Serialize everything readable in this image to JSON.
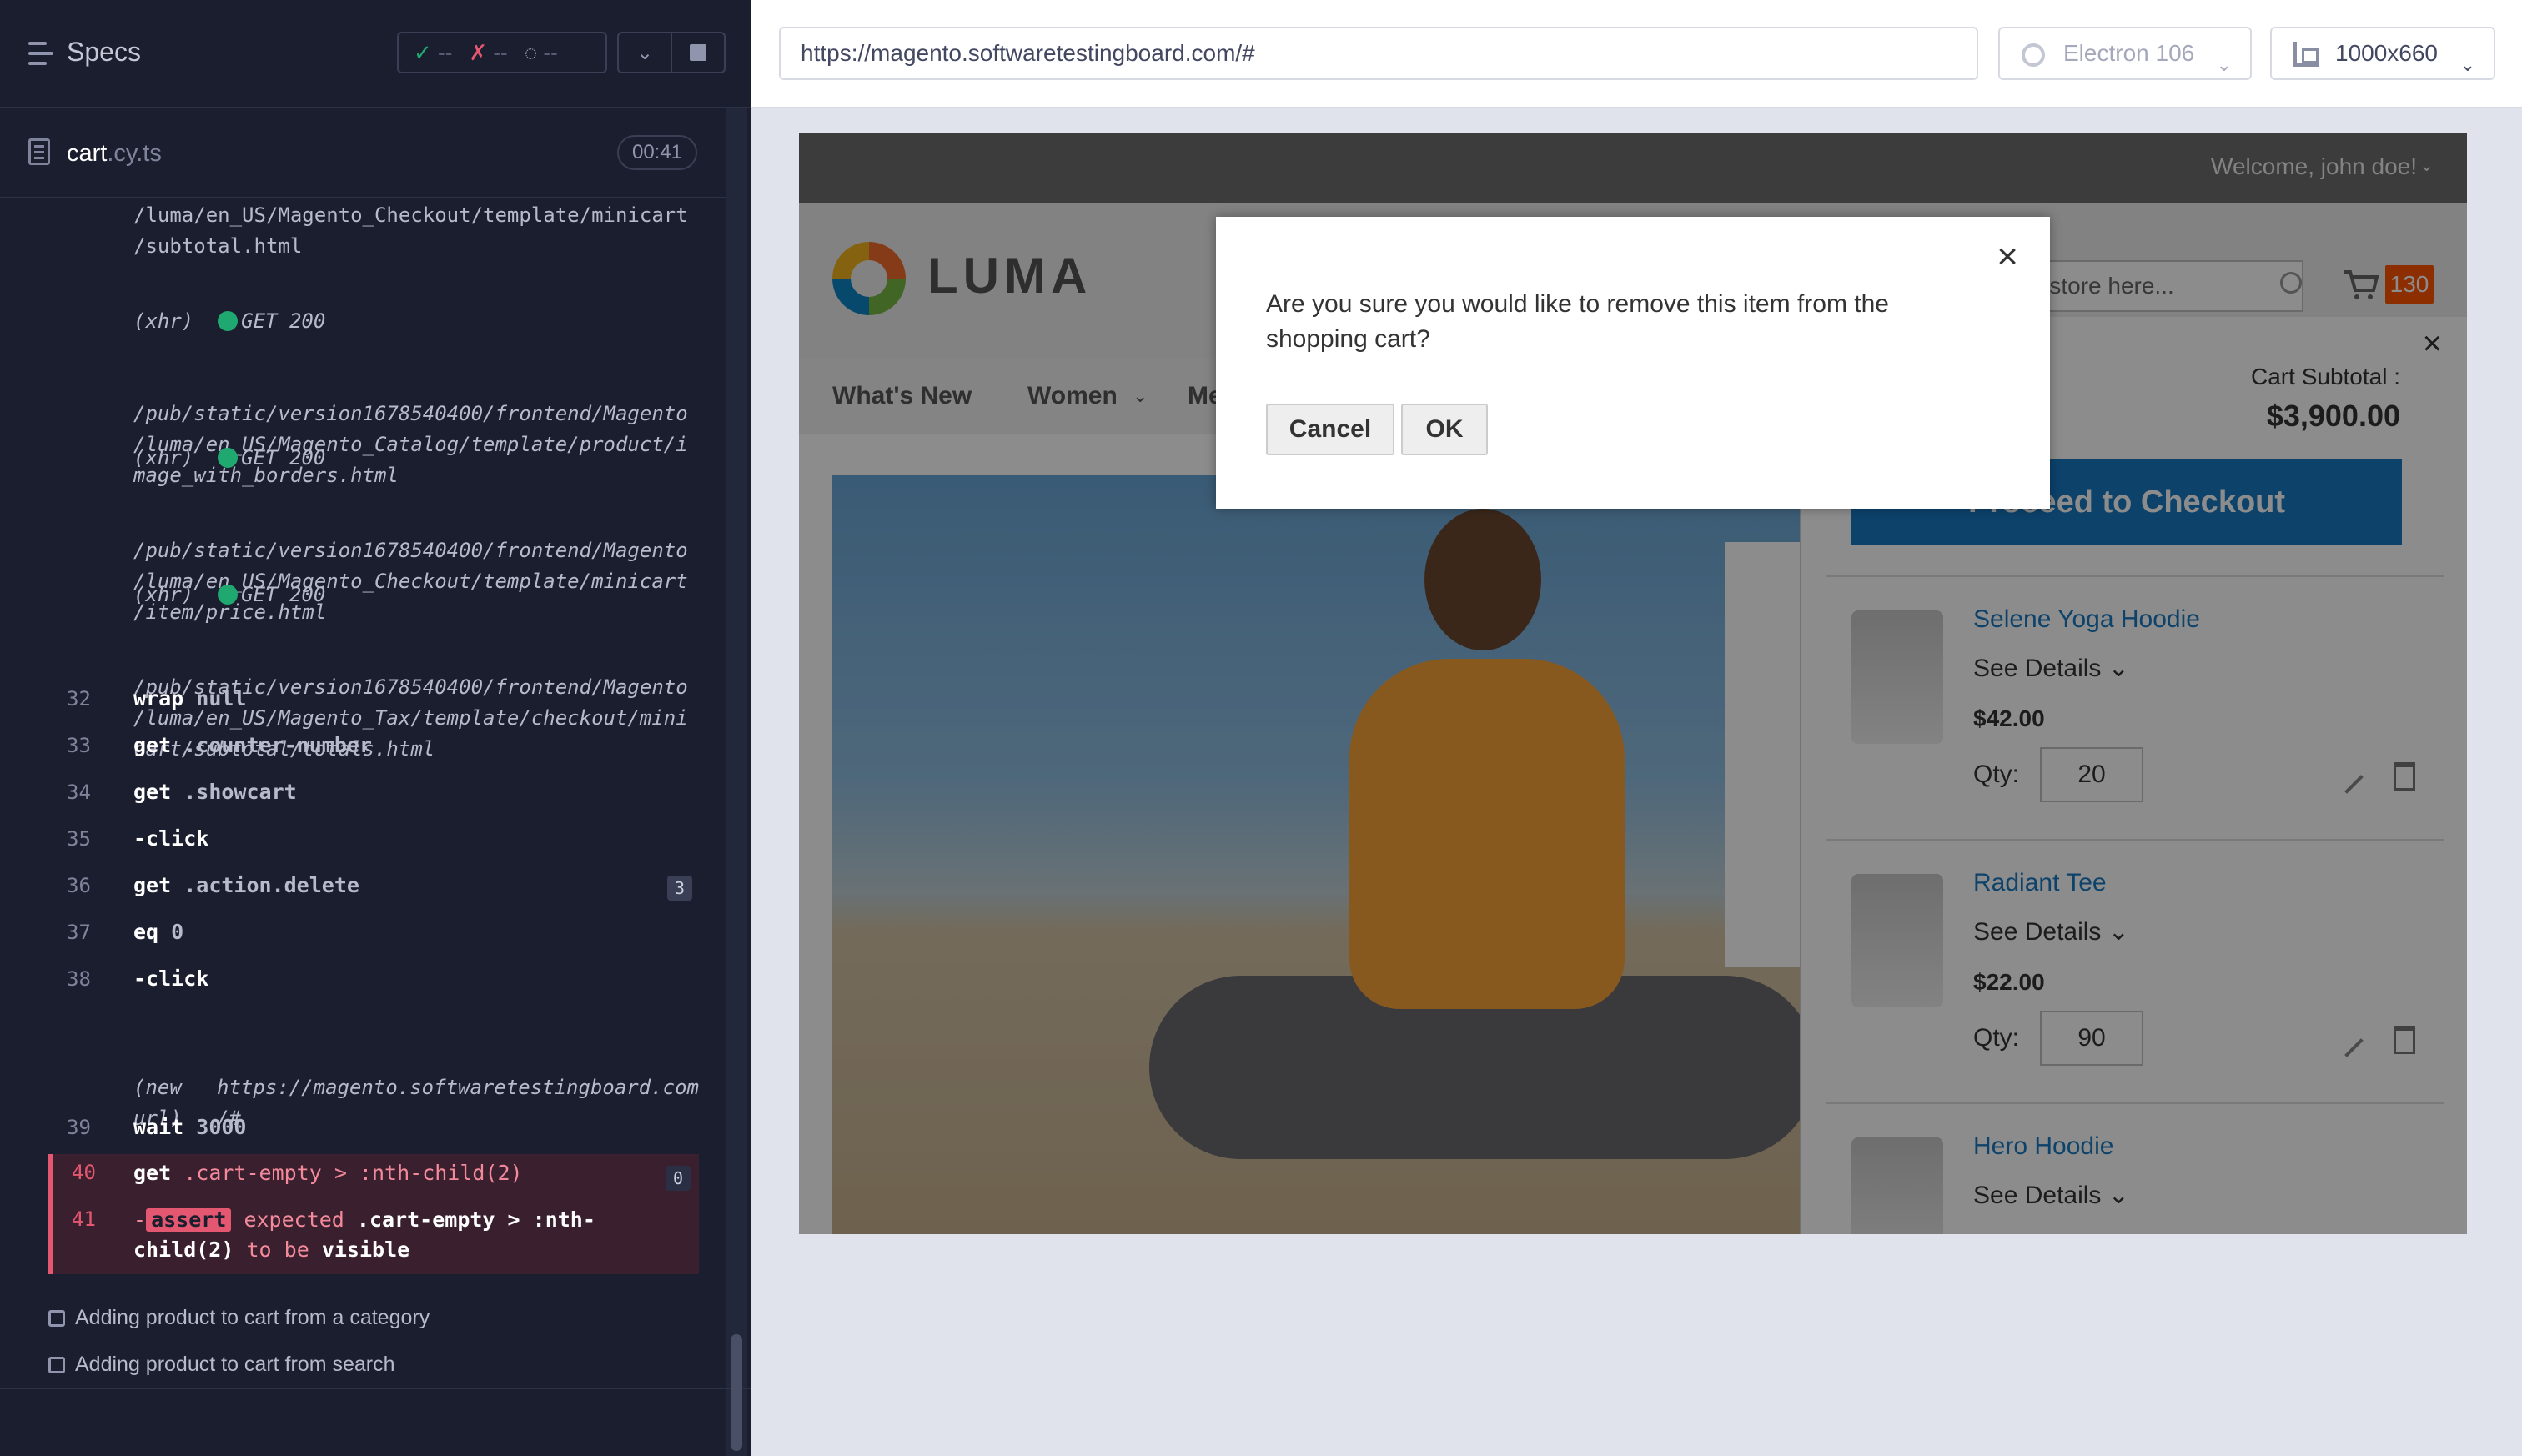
{
  "runner": {
    "title": "Specs",
    "stats": {
      "passed": "--",
      "failed": "--",
      "pending": "--"
    },
    "spec_file": {
      "name": "cart",
      "ext": ".cy.ts",
      "timer": "00:41"
    },
    "xhr_prefix_cont": "/luma/en_US/Magento_Checkout/template/minicart\n/subtotal.html",
    "xhr": [
      {
        "label": "(xhr)",
        "method": "GET 200",
        "url": "/pub/static/version1678540400/frontend/Magento\n/luma/en_US/Magento_Catalog/template/product/i\nmage_with_borders.html"
      },
      {
        "label": "(xhr)",
        "method": "GET 200",
        "url": "/pub/static/version1678540400/frontend/Magento\n/luma/en_US/Magento_Checkout/template/minicart\n/item/price.html"
      },
      {
        "label": "(xhr)",
        "method": "GET 200",
        "url": "/pub/static/version1678540400/frontend/Magento\n/luma/en_US/Magento_Tax/template/checkout/mini\ncart/subtotal/totals.html"
      }
    ],
    "commands": [
      {
        "num": "32",
        "name": "wrap",
        "arg": "null"
      },
      {
        "num": "33",
        "name": "get",
        "arg": ".counter-number"
      },
      {
        "num": "34",
        "name": "get",
        "arg": ".showcart"
      },
      {
        "num": "35",
        "name": "-click",
        "arg": ""
      },
      {
        "num": "36",
        "name": "get",
        "arg": ".action.delete",
        "badge": "3"
      },
      {
        "num": "37",
        "name": "eq",
        "arg": "0"
      },
      {
        "num": "38",
        "name": "-click",
        "arg": ""
      }
    ],
    "new_url": {
      "label": "(new\nurl)",
      "url": "https://magento.softwaretestingboard.com\n/#"
    },
    "wait": {
      "num": "39",
      "name": "wait",
      "arg": "3000"
    },
    "failed_get": {
      "num": "40",
      "name": "get",
      "arg": ".cart-empty > :nth-child(2)",
      "badge": "0"
    },
    "failed_assert": {
      "num": "41",
      "chip": "assert",
      "text1": "expected",
      "sel1": ".cart-empty > :nth-",
      "sel2": "child(2)",
      "text2": "to be",
      "word": "visible"
    },
    "tests": [
      "Adding product to cart from a category",
      "Adding product to cart from search"
    ]
  },
  "browser": {
    "url": "https://magento.softwaretestingboard.com/#",
    "browser_name": "Electron 106",
    "viewport": "1000x660"
  },
  "aut": {
    "welcome": "Welcome, john doe!",
    "logo_text": "LUMA",
    "search_placeholder": "e store here...",
    "cart_count": "130",
    "nav": [
      "What's New",
      "Women",
      "Me"
    ],
    "minicart": {
      "subtotal_label": "Cart Subtotal :",
      "subtotal": "$3,900.00",
      "checkout": "Proceed to Checkout",
      "qty_label": "Qty:",
      "see_details": "See Details",
      "items": [
        {
          "name": "Selene Yoga Hoodie",
          "price": "$42.00",
          "qty": "20"
        },
        {
          "name": "Radiant Tee",
          "price": "$22.00",
          "qty": "90"
        },
        {
          "name": "Hero Hoodie",
          "price": "",
          "qty": ""
        }
      ]
    },
    "modal": {
      "message": "Are you sure you would like to remove this item from the shopping cart?",
      "cancel": "Cancel",
      "ok": "OK"
    }
  }
}
